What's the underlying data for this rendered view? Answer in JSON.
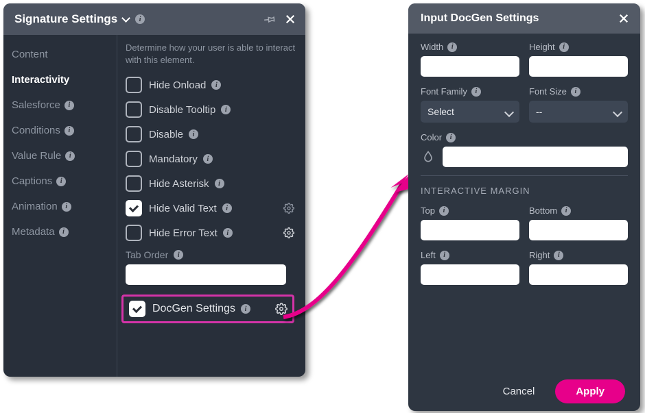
{
  "left": {
    "title": "Signature Settings",
    "sidebar": [
      {
        "label": "Content",
        "info": false,
        "active": false
      },
      {
        "label": "Interactivity",
        "info": false,
        "active": true
      },
      {
        "label": "Salesforce",
        "info": true,
        "active": false
      },
      {
        "label": "Conditions",
        "info": true,
        "active": false
      },
      {
        "label": "Value Rule",
        "info": true,
        "active": false
      },
      {
        "label": "Captions",
        "info": true,
        "active": false
      },
      {
        "label": "Animation",
        "info": true,
        "active": false
      },
      {
        "label": "Metadata",
        "info": true,
        "active": false
      }
    ],
    "desc": "Determine how your user is able to interact with this element.",
    "checks": [
      {
        "label": "Hide Onload",
        "checked": false,
        "gear": "none"
      },
      {
        "label": "Disable Tooltip",
        "checked": false,
        "gear": "none"
      },
      {
        "label": "Disable",
        "checked": false,
        "gear": "none"
      },
      {
        "label": "Mandatory",
        "checked": false,
        "gear": "none"
      },
      {
        "label": "Hide Asterisk",
        "checked": false,
        "gear": "none"
      },
      {
        "label": "Hide Valid Text",
        "checked": true,
        "gear": "dim"
      },
      {
        "label": "Hide Error Text",
        "checked": false,
        "gear": "bright"
      }
    ],
    "tabOrderLabel": "Tab Order",
    "tabOrderValue": "",
    "docgen": {
      "label": "DocGen Settings",
      "checked": true
    }
  },
  "right": {
    "title": "Input DocGen Settings",
    "widthLabel": "Width",
    "heightLabel": "Height",
    "fontFamilyLabel": "Font Family",
    "fontFamilyValue": "Select",
    "fontSizeLabel": "Font Size",
    "fontSizeValue": "--",
    "colorLabel": "Color",
    "colorValue": "",
    "marginTitle": "INTERACTIVE MARGIN",
    "topLabel": "Top",
    "bottomLabel": "Bottom",
    "leftLabel": "Left",
    "rightLabel": "Right",
    "cancel": "Cancel",
    "apply": "Apply"
  }
}
